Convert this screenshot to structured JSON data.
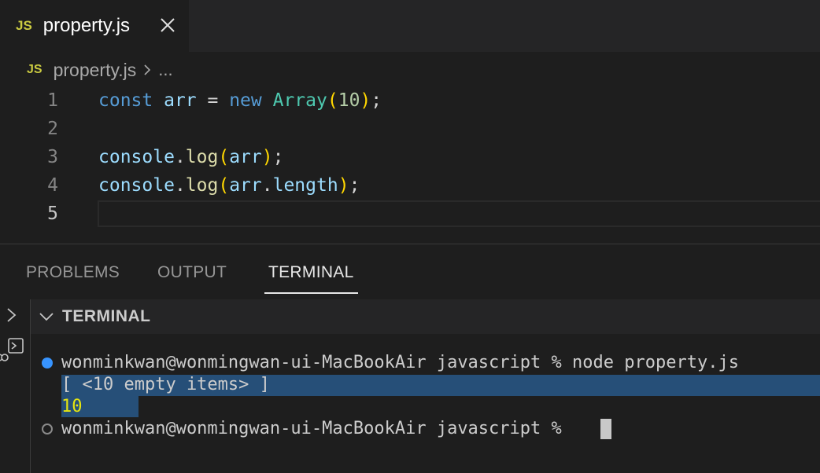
{
  "tab": {
    "badge": "JS",
    "title": "property.js",
    "close_icon": "close-icon"
  },
  "breadcrumb": {
    "badge": "JS",
    "file": "property.js",
    "more": "..."
  },
  "editor": {
    "lines": [
      {
        "number": "1"
      },
      {
        "number": "2"
      },
      {
        "number": "3"
      },
      {
        "number": "4"
      },
      {
        "number": "5"
      }
    ],
    "code": {
      "l1": {
        "kw": "const",
        "var": "arr",
        "eq": " = ",
        "new": "new",
        "cls": "Array",
        "open": "(",
        "num": "10",
        "close": ")",
        "semi": ";"
      },
      "l3": {
        "obj": "console",
        "dot": ".",
        "fn": "log",
        "open": "(",
        "var": "arr",
        "close": ")",
        "semi": ";"
      },
      "l4": {
        "obj": "console",
        "dot": ".",
        "fn": "log",
        "open": "(",
        "var": "arr",
        "dot2": ".",
        "prop": "length",
        "close": ")",
        "semi": ";"
      }
    }
  },
  "panel": {
    "tabs": [
      {
        "label": "PROBLEMS"
      },
      {
        "label": "OUTPUT"
      },
      {
        "label": "TERMINAL"
      }
    ],
    "active_tab": "TERMINAL",
    "terminal_header": "TERMINAL"
  },
  "terminal": {
    "prompt1": "wonminkwan@wonmingwan-ui-MacBookAir javascript % node property.js",
    "output1": "[ <10 empty items> ]",
    "output2": "10",
    "prompt2": "wonminkwan@wonmingwan-ui-MacBookAir javascript % "
  },
  "colors": {
    "keyword": "#569cd6",
    "variable": "#9cdcfe",
    "class": "#4ec9b0",
    "function": "#dcdcaa",
    "number": "#b5cea8",
    "bracket": "#ffd700",
    "selection": "#264f78",
    "decoration_dot": "#3794ff"
  }
}
